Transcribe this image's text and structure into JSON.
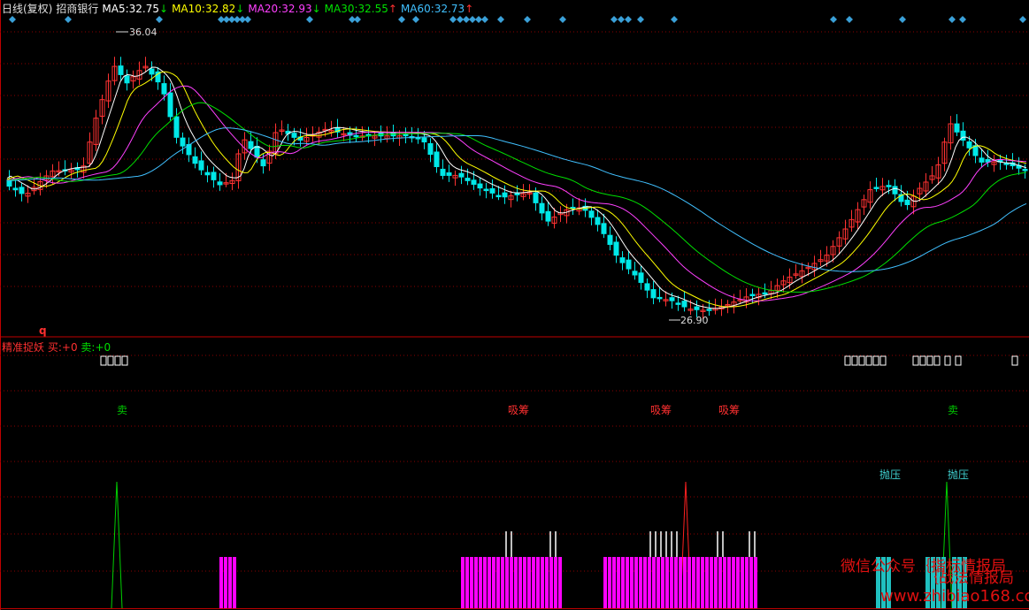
{
  "header": {
    "period": "日线(复权)",
    "stock": "招商银行",
    "ma5": {
      "label": "MA5:",
      "value": "32.75",
      "arrow": "↓",
      "color": "#ffffff"
    },
    "ma10": {
      "label": "MA10:",
      "value": "32.82",
      "arrow": "↓",
      "color": "#ffff00"
    },
    "ma20": {
      "label": "MA20:",
      "value": "32.93",
      "arrow": "↓",
      "color": "#ff40ff"
    },
    "ma30": {
      "label": "MA30:",
      "value": "32.55",
      "arrow": "↑",
      "color": "#00e000"
    },
    "ma60": {
      "label": "MA60:",
      "value": "32.73",
      "arrow": "↑",
      "color": "#40c0ff"
    }
  },
  "indicator": {
    "name": "精准捉妖",
    "buy_label": "买:",
    "buy_value": "+0",
    "sell_label": "卖:",
    "sell_value": "+0"
  },
  "watermark": {
    "line1a": "微信公众号",
    "line1b": "指标情报局",
    "line2": "战法情报局",
    "url": "www.zhibiao168.com"
  },
  "colors": {
    "up": "#ff3232",
    "down": "#00e8e8",
    "grid": "#8b0000",
    "magenta": "#ff00ff",
    "cyan": "#20c0c0",
    "buy_text": "#ff3030",
    "sell_text": "#00c800",
    "diamond": "#3aa0d8"
  },
  "chart_data": [
    {
      "type": "candlestick",
      "title": "招商银行 日线(复权)",
      "annotations": [
        {
          "text": "36.04",
          "kind": "high"
        },
        {
          "text": "26.90",
          "kind": "low"
        },
        {
          "text": "q",
          "kind": "marker"
        }
      ],
      "ma_lines": [
        "MA5",
        "MA10",
        "MA20",
        "MA30",
        "MA60"
      ],
      "grid": true
    },
    {
      "type": "bar",
      "title": "精准捉妖",
      "signals": [
        {
          "text": "卖",
          "type": "sell"
        },
        {
          "text": "吸筹",
          "type": "buy"
        },
        {
          "text": "吸筹",
          "type": "buy"
        },
        {
          "text": "吸筹",
          "type": "buy"
        },
        {
          "text": "卖",
          "type": "sell"
        },
        {
          "text": "抛压",
          "type": "pressure"
        },
        {
          "text": "抛压",
          "type": "pressure"
        }
      ],
      "grid": true
    }
  ]
}
